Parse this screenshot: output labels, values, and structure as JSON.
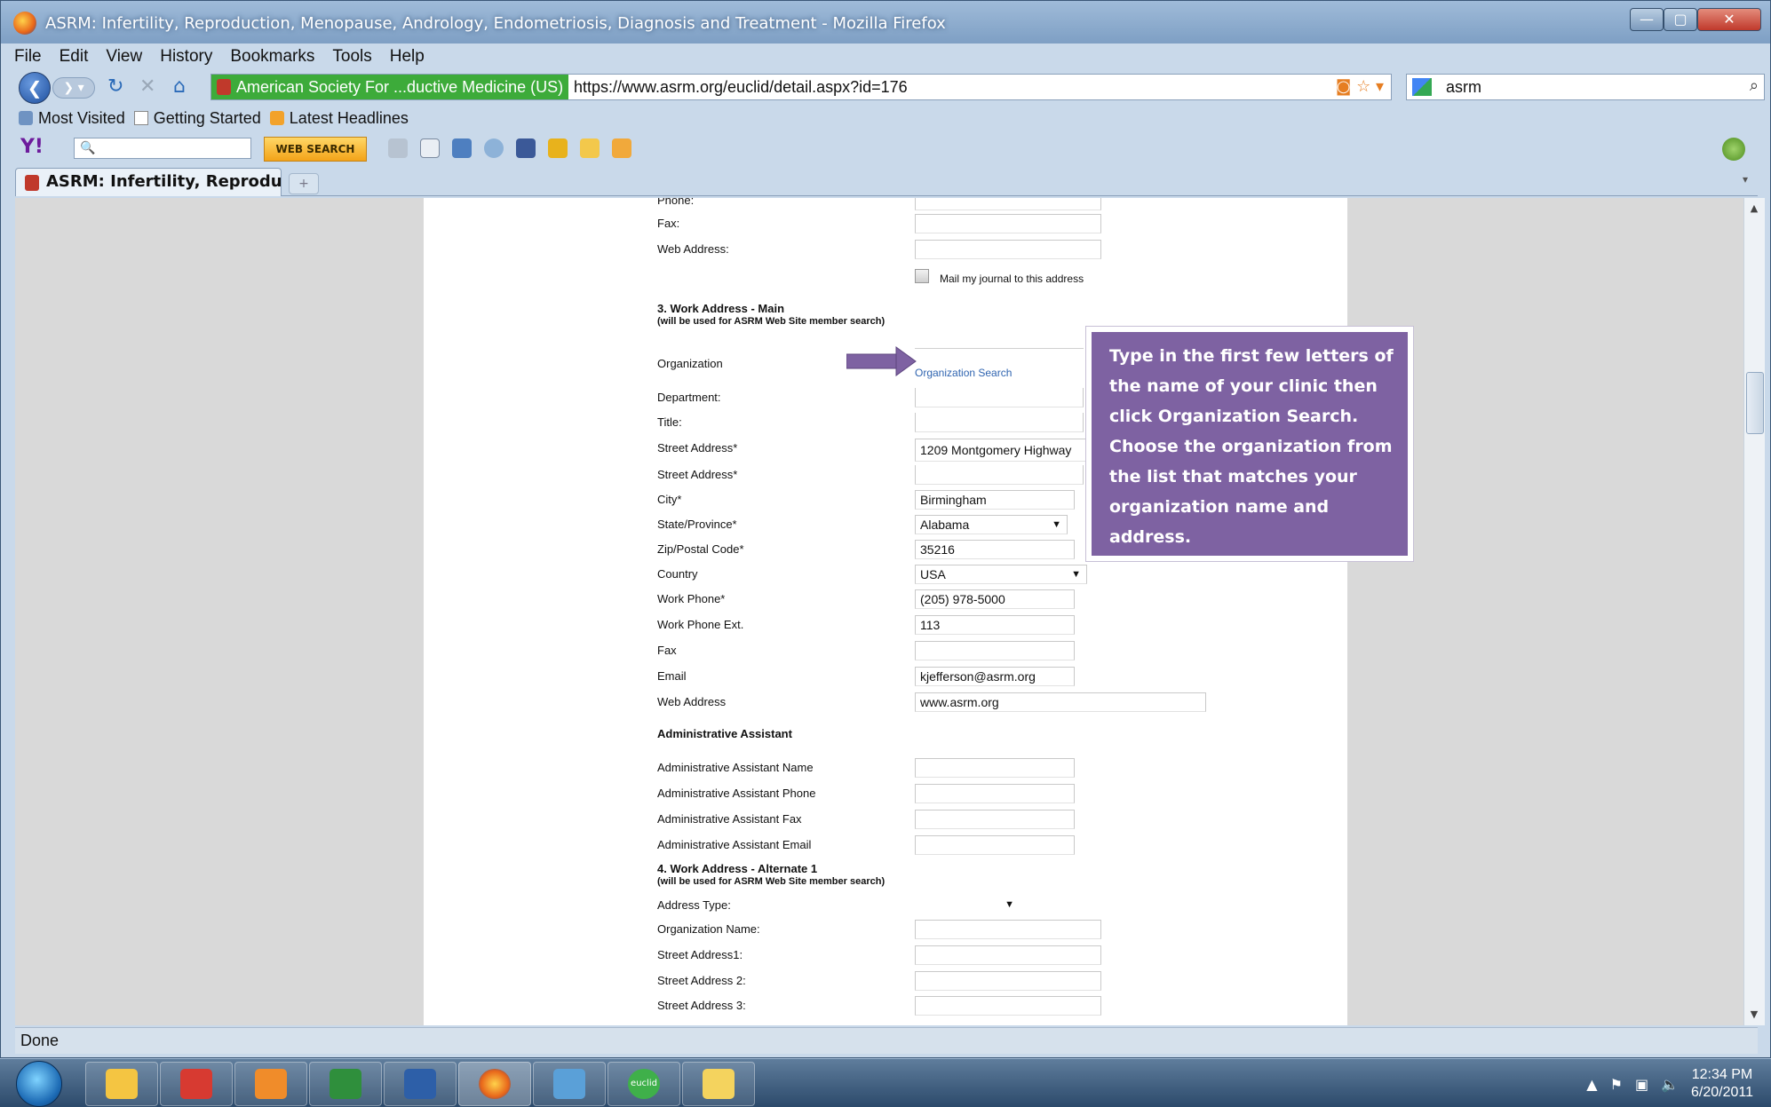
{
  "window": {
    "title": "ASRM: Infertility, Reproduction, Menopause, Andrology, Endometriosis, Diagnosis and Treatment - Mozilla Firefox",
    "min_glyph": "—",
    "max_glyph": "▢",
    "close_glyph": "✕"
  },
  "menu": [
    "File",
    "Edit",
    "View",
    "History",
    "Bookmarks",
    "Tools",
    "Help"
  ],
  "navbar": {
    "identity": "American Society For ...ductive Medicine (US)",
    "url": "https://www.asrm.org/euclid/detail.aspx?id=176",
    "search_text": "asrm"
  },
  "bookmarks": [
    "Most Visited",
    "Getting Started",
    "Latest Headlines"
  ],
  "yahoo": {
    "logo": "Y!",
    "web_search": "WEB SEARCH"
  },
  "tab": {
    "label": "ASRM: Infertility, Reproducti...",
    "newtab": "+"
  },
  "form": {
    "rows_top": [
      {
        "label": "Phone:",
        "value": ""
      },
      {
        "label": "Fax:",
        "value": ""
      },
      {
        "label": "Web Address:",
        "value": ""
      }
    ],
    "mail_journal": "Mail my journal to this address",
    "section3_title": "3. Work Address - Main",
    "section3_sub": "(will be used for ASRM Web Site member search)",
    "org_label": "Organization",
    "org_search": "Organization Search",
    "rows_main": [
      {
        "label": "Department:",
        "value": ""
      },
      {
        "label": "Title:",
        "value": ""
      },
      {
        "label": "Street Address*",
        "value": "1209 Montgomery Highway"
      },
      {
        "label": "Street Address*",
        "value": ""
      },
      {
        "label": "City*",
        "value": "Birmingham"
      },
      {
        "label": "State/Province*",
        "value": "Alabama"
      },
      {
        "label": "Zip/Postal Code*",
        "value": "35216"
      },
      {
        "label": "Country",
        "value": "USA"
      },
      {
        "label": "Work Phone*",
        "value": "(205) 978-5000"
      },
      {
        "label": "Work Phone Ext.",
        "value": "113"
      },
      {
        "label": "Fax",
        "value": ""
      },
      {
        "label": "Email",
        "value": "kjefferson@asrm.org"
      },
      {
        "label": "Web Address",
        "value": "www.asrm.org"
      }
    ],
    "admin_title": "Administrative Assistant",
    "rows_admin": [
      {
        "label": "Administrative Assistant Name",
        "value": ""
      },
      {
        "label": "Administrative Assistant Phone",
        "value": ""
      },
      {
        "label": "Administrative Assistant Fax",
        "value": ""
      },
      {
        "label": "Administrative Assistant Email",
        "value": ""
      }
    ],
    "section4_title": "4. Work Address - Alternate 1",
    "section4_sub": "(will be used for ASRM Web Site member search)",
    "rows_alt": [
      {
        "label": "Address Type:",
        "value": ""
      },
      {
        "label": "Organization Name:",
        "value": ""
      },
      {
        "label": "Street Address1:",
        "value": ""
      },
      {
        "label": "Street Address 2:",
        "value": ""
      },
      {
        "label": "Street Address 3:",
        "value": ""
      }
    ]
  },
  "callout": {
    "text": "Type in the first few letters of the name of your clinic then click Organization Search. Choose the organization from the list that matches your organization name and address."
  },
  "status": "Done",
  "taskbar": {
    "time": "12:34 PM",
    "date": "6/20/2011",
    "apps": [
      "explorer-icon",
      "acrobat-icon",
      "outlook-icon",
      "excel-icon",
      "word-icon",
      "firefox-icon",
      "notepad-icon",
      "euclid-icon",
      "sticky-notes-icon"
    ],
    "app_colors": [
      "#f4c542",
      "#d73a31",
      "#f08c2a",
      "#2f8f3c",
      "#2d5fa8",
      "#e8661a",
      "#5aa0d8",
      "#3fb04a",
      "#f4d35e"
    ],
    "euclid_label": "euclid"
  },
  "colors": {
    "callout_bg": "#7e62a2",
    "identity_bg": "#3dab3a",
    "link": "#2f64b0"
  }
}
